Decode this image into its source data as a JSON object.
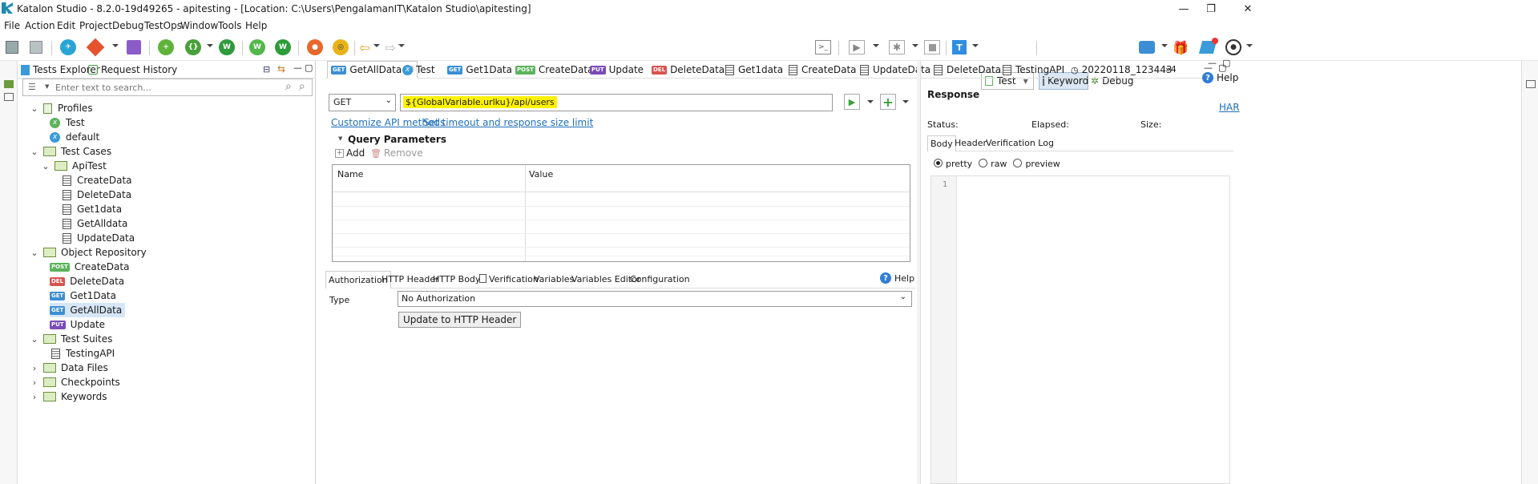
{
  "window": {
    "title": "Katalon Studio - 8.2.0-19d49265 - apitesting - [Location: C:\\Users\\PengalamanIT\\Katalon Studio\\apitesting]",
    "minimize": "—",
    "maximize": "❐",
    "close": "✕"
  },
  "menu": [
    "File",
    "Action",
    "Edit",
    "Project",
    "Debug",
    "TestOps",
    "Window",
    "Tools",
    "Help"
  ],
  "toolbar": {
    "profile": "Test",
    "keyword": "Keyword",
    "debug": "Debug"
  },
  "explorer": {
    "tab_tests": "Tests Explorer",
    "tab_history": "Request History",
    "search_placeholder": "Enter text to search...",
    "tree": {
      "profiles": "Profiles",
      "profile_items": [
        "Test",
        "default"
      ],
      "test_cases": "Test Cases",
      "api_test": "ApiTest",
      "test_case_items": [
        "CreateData",
        "DeleteData",
        "Get1data",
        "GetAlldata",
        "UpdateData"
      ],
      "object_repository": "Object Repository",
      "object_items": [
        {
          "method": "POST",
          "label": "CreateData"
        },
        {
          "method": "DEL",
          "label": "DeleteData"
        },
        {
          "method": "GET",
          "label": "Get1Data"
        },
        {
          "method": "GET",
          "label": "GetAllData"
        },
        {
          "method": "PUT",
          "label": "Update"
        }
      ],
      "test_suites": "Test Suites",
      "suite_items": [
        "TestingAPI"
      ],
      "data_files": "Data Files",
      "checkpoints": "Checkpoints",
      "keywords": "Keywords"
    }
  },
  "editor": {
    "tabs": [
      {
        "badge": "GET",
        "label": "GetAllData"
      },
      {
        "badge": "X",
        "label": "Test"
      },
      {
        "badge": "GET",
        "label": "Get1Data"
      },
      {
        "badge": "POST",
        "label": "CreateData"
      },
      {
        "badge": "PUT",
        "label": "Update"
      },
      {
        "badge": "DEL",
        "label": "DeleteData"
      },
      {
        "badge": "DOC",
        "label": "Get1data"
      },
      {
        "badge": "DOC",
        "label": "CreateData"
      },
      {
        "badge": "DOC",
        "label": "UpdateData"
      },
      {
        "badge": "DOC",
        "label": "DeleteData"
      },
      {
        "badge": "DOC",
        "label": "TestingAPI"
      },
      {
        "badge": "CLOCK",
        "label": "20220118_123443"
      }
    ],
    "overflow": "»4",
    "help": "Help",
    "method": "GET",
    "url": "${GlobalVariable.urlku}/api/users",
    "customize_link": "Customize API methods",
    "timeout_link": "Set timeout and response size limit",
    "query_params": "Query Parameters",
    "add": "Add",
    "remove": "Remove",
    "col_name": "Name",
    "col_value": "Value",
    "subtabs": [
      "Authorization",
      "HTTP Header",
      "HTTP Body",
      "Verification",
      "Variables",
      "Variables Editor",
      "Configuration"
    ],
    "subtab_help": "Help",
    "type_label": "Type",
    "auth_type": "No Authorization",
    "update_header_btn": "Update to HTTP Header"
  },
  "response": {
    "title": "Response",
    "har": "HAR",
    "status": "Status:",
    "elapsed": "Elapsed:",
    "size": "Size:",
    "tabs": [
      "Body",
      "Header",
      "Verification Log"
    ],
    "formats": [
      "pretty",
      "raw",
      "preview"
    ],
    "line_number": "1"
  }
}
